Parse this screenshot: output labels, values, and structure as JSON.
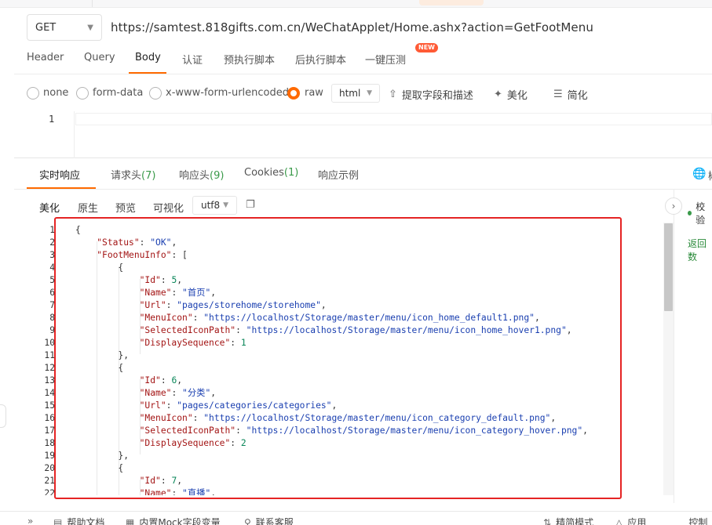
{
  "request": {
    "method": "GET",
    "url": "https://samtest.818gifts.com.cn/WeChatApplet/Home.ashx?action=GetFootMenu"
  },
  "request_tabs": {
    "header": "Header",
    "query": "Query",
    "body": "Body",
    "auth": "认证",
    "pre_script": "预执行脚本",
    "post_script": "后执行脚本",
    "stress": "一键压测",
    "new_badge": "NEW"
  },
  "body_types": {
    "none": "none",
    "form_data": "form-data",
    "urlencoded": "x-www-form-urlencoded",
    "raw": "raw",
    "format": "html",
    "extract": "提取字段和描述",
    "beautify": "美化",
    "simplify": "简化"
  },
  "body_editor": {
    "line1": "1"
  },
  "response_tabs": {
    "live": "实时响应",
    "req_headers": "请求头",
    "req_headers_count": "(7)",
    "resp_headers": "响应头",
    "resp_headers_count": "(9)",
    "cookies": "Cookies",
    "cookies_count": "(1)",
    "example": "响应示例",
    "partial": "椒"
  },
  "view_modes": {
    "pretty": "美化",
    "raw": "原生",
    "preview": "预览",
    "visual": "可视化",
    "encoding": "utf8"
  },
  "side_panel": {
    "check": "校验",
    "return": "返回数"
  },
  "code_lines": [
    "{",
    "    \"Status\": \"OK\",",
    "    \"FootMenuInfo\": [",
    "        {",
    "            \"Id\": 5,",
    "            \"Name\": \"首页\",",
    "            \"Url\": \"pages/storehome/storehome\",",
    "            \"MenuIcon\": \"https://localhost/Storage/master/menu/icon_home_default1.png\",",
    "            \"SelectedIconPath\": \"https://localhost/Storage/master/menu/icon_home_hover1.png\",",
    "            \"DisplaySequence\": 1",
    "        },",
    "        {",
    "            \"Id\": 6,",
    "            \"Name\": \"分类\",",
    "            \"Url\": \"pages/categories/categories\",",
    "            \"MenuIcon\": \"https://localhost/Storage/master/menu/icon_category_default.png\",",
    "            \"SelectedIconPath\": \"https://localhost/Storage/master/menu/icon_category_hover.png\",",
    "            \"DisplaySequence\": 2",
    "        },",
    "        {",
    "            \"Id\": 7,",
    "            \"Name\": \"直播\","
  ],
  "bottom_bar": {
    "help": "帮助文档",
    "mock": "内置Mock字段变量",
    "support": "联系客服",
    "mode": "精简模式",
    "apply": "应用",
    "console": "控制台"
  }
}
